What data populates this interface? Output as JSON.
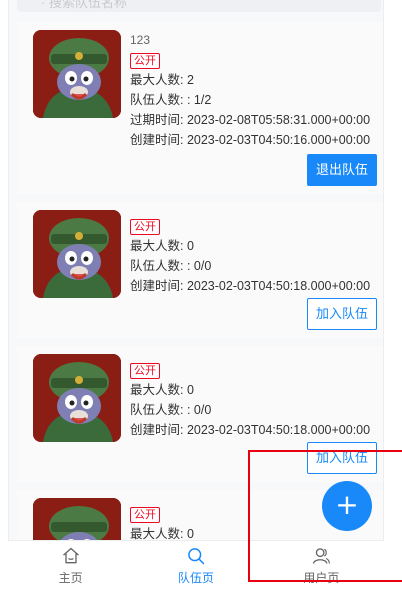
{
  "top_hint": "· 搜索队伍名称",
  "teams": [
    {
      "name": "123",
      "tag": "公开",
      "lines": [
        "最大人数: 2",
        "队伍人数: : 1/2",
        "过期时间: 2023-02-08T05:58:31.000+00:00",
        "创建时间: 2023-02-03T04:50:16.000+00:00"
      ],
      "button": "退出队伍"
    },
    {
      "name": "",
      "tag": "公开",
      "lines": [
        "最大人数: 0",
        "队伍人数: : 0/0",
        "创建时间: 2023-02-03T04:50:18.000+00:00"
      ],
      "button": "加入队伍"
    },
    {
      "name": "",
      "tag": "公开",
      "lines": [
        "最大人数: 0",
        "队伍人数: : 0/0",
        "创建时间: 2023-02-03T04:50:18.000+00:00"
      ],
      "button": "加入队伍"
    },
    {
      "name": "",
      "tag": "公开",
      "lines": [
        "最大人数: 0"
      ],
      "button": ""
    }
  ],
  "tabbar": [
    {
      "label": "主页",
      "icon": "home-icon"
    },
    {
      "label": "队伍页",
      "icon": "search-icon"
    },
    {
      "label": "用户页",
      "icon": "user-icon"
    }
  ],
  "fab_symbol": "+",
  "colors": {
    "accent": "#1989fa",
    "tag": "#ee0a24",
    "highlight": "#e60012",
    "avatar_bg": "#8b1e14"
  }
}
